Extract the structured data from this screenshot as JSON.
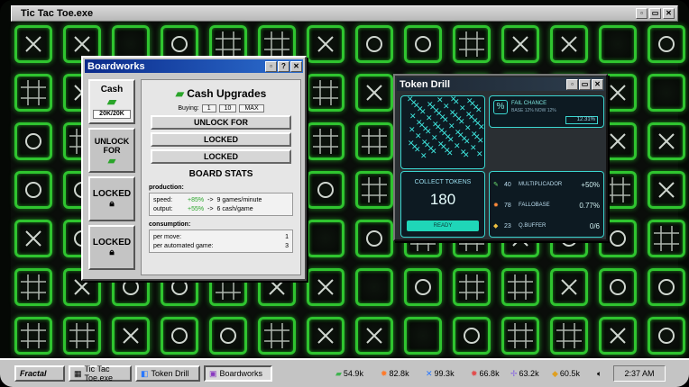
{
  "main_window": {
    "title": "Tic Tac Toe.exe",
    "buttons": [
      "▫",
      "▭",
      "✕"
    ]
  },
  "boardworks": {
    "title": "Boardworks",
    "buttons": [
      "▫",
      "?",
      "✕"
    ],
    "tabs": [
      {
        "label": "Cash",
        "count": "20K/20K"
      },
      {
        "label": "UNLOCK FOR",
        "count": ""
      },
      {
        "label": "LOCKED",
        "count": ""
      },
      {
        "label": "LOCKED",
        "count": ""
      }
    ],
    "header": "Cash Upgrades",
    "buying_label": "Buying:",
    "buying_options": [
      "1",
      "10",
      "MAX"
    ],
    "upgrades": [
      "UNLOCK FOR",
      "LOCKED",
      "LOCKED"
    ],
    "stats_title": "BOARD STATS",
    "production_label": "production:",
    "production": [
      {
        "name": "speed:",
        "bonus": "+85%",
        "arrow": "->",
        "value": "9 games/minute"
      },
      {
        "name": "output:",
        "bonus": "+55%",
        "arrow": "->",
        "value": "6 cash/game"
      }
    ],
    "consumption_label": "consumption:",
    "consumption": [
      {
        "name": "per move:",
        "value": "1"
      },
      {
        "name": "per automated game:",
        "value": "3"
      }
    ]
  },
  "drill": {
    "title": "Token Drill",
    "buttons": [
      "▫",
      "▭",
      "✕"
    ],
    "fail_title": "FAIL CHANCE",
    "fail_sub": "BASE 12% NOW 12%",
    "fail_value": "12.31%",
    "collect_label": "COLLECT TOKENS",
    "collect_value": "180",
    "ready_label": "READY",
    "upgrades": [
      {
        "icon": "✎",
        "level": "40",
        "name": "MULTIPLICADOR",
        "value": "+50%",
        "color": "#6ee06e"
      },
      {
        "icon": "✹",
        "level": "78",
        "name": "FALLOBASE",
        "value": "0.77%",
        "color": "#ff8a3a"
      },
      {
        "icon": "◆",
        "level": "23",
        "name": "Q.BUFFER",
        "value": "0/6",
        "color": "#f0c040"
      }
    ]
  },
  "taskbar": {
    "start": "Fractal",
    "items": [
      "Tic Tac Toe.exe",
      "Token Drill",
      "Boardworks"
    ],
    "resources": [
      {
        "icon": "▰",
        "value": "54.9k",
        "color": "#3fb34f"
      },
      {
        "icon": "✹",
        "value": "82.8k",
        "color": "#ff7a2a"
      },
      {
        "icon": "✕",
        "value": "99.3k",
        "color": "#2a78ff"
      },
      {
        "icon": "✹",
        "value": "66.8k",
        "color": "#e24d4d"
      },
      {
        "icon": "✢",
        "value": "63.2k",
        "color": "#8a6ae0"
      },
      {
        "icon": "◆",
        "value": "60.5k",
        "color": "#e0a020"
      }
    ],
    "clock": "2:37 AM"
  }
}
